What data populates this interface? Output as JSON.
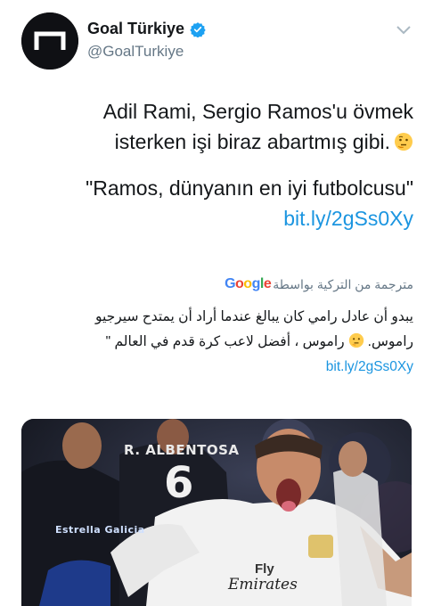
{
  "header": {
    "display_name": "Goal Türkiye",
    "handle": "@GoalTurkiye",
    "verified_icon": "verified-badge-icon",
    "menu_icon": "chevron-down-icon"
  },
  "tweet": {
    "line1": "Adil Rami, Sergio Ramos'u övmek",
    "line2": "isterken işi biraz abartmış gibi.",
    "line2_emoji": "thinking-face-emoji",
    "quote": "\"Ramos, dünyanın en iyi futbolcusu\"",
    "link": "bit.ly/2gSs0Xy"
  },
  "translation": {
    "provider": "Google",
    "label": "مترجمة من التركية بواسطة",
    "line1": "يبدو أن عادل رامي كان يبالغ عندما أراد أن يمتدح سيرجيو",
    "line2_a": "راموس.",
    "line2_b": "راموس ، أفضل لاعب كرة قدم في العالم \"",
    "link": "bit.ly/2gSs0Xy"
  },
  "media": {
    "player_name": "R. ALBENTOSA",
    "player_number": "6",
    "sponsor_1": "Fly",
    "sponsor_2": "Emirates",
    "badge_text": "Estrella Galicia"
  },
  "colors": {
    "link": "#1b95e0",
    "secondary_text": "#657786",
    "verified": "#1da1f2"
  }
}
